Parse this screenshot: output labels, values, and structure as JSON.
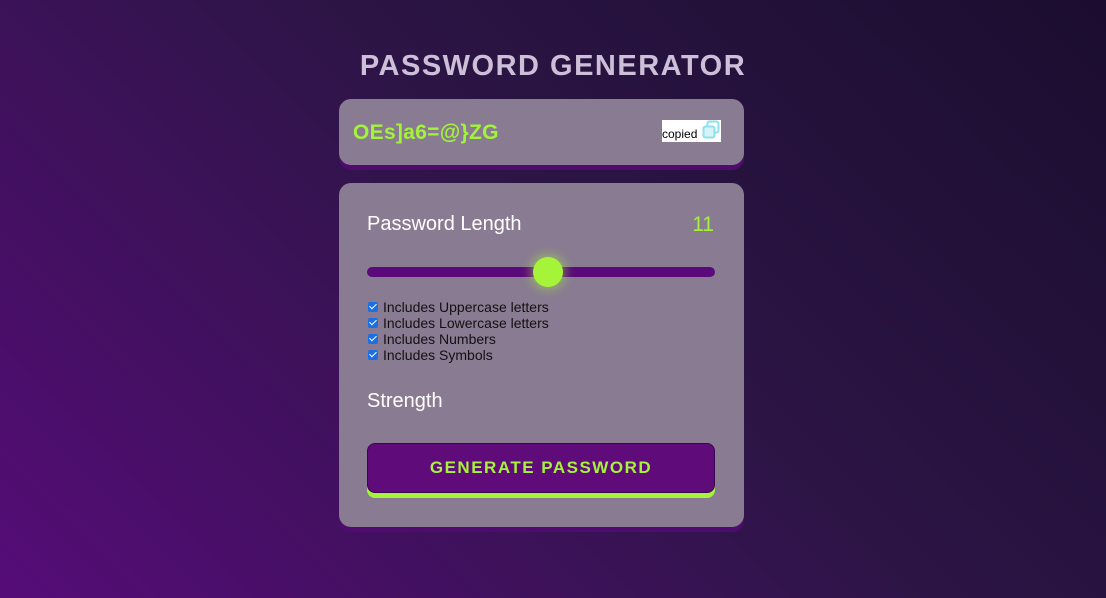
{
  "app": {
    "title": "PASSWORD GENERATOR"
  },
  "display": {
    "password": "OEs]a6=@}ZG",
    "copied_label": "copied",
    "copy_icon": "copy-icon"
  },
  "length": {
    "label": "Password Length",
    "value": "11",
    "slider_fraction": 0.52
  },
  "options": [
    {
      "label": "Includes Uppercase letters",
      "checked": true
    },
    {
      "label": "Includes Lowercase letters",
      "checked": true
    },
    {
      "label": "Includes Numbers",
      "checked": true
    },
    {
      "label": "Includes Symbols",
      "checked": true
    }
  ],
  "strength": {
    "label": "Strength"
  },
  "generate_button": {
    "label": "GENERATE PASSWORD"
  },
  "colors": {
    "accent": "#a6f43a",
    "panel": "#897b92",
    "button": "#5f0b7a",
    "track": "#5a0a7a",
    "title": "#cdbfd8"
  }
}
